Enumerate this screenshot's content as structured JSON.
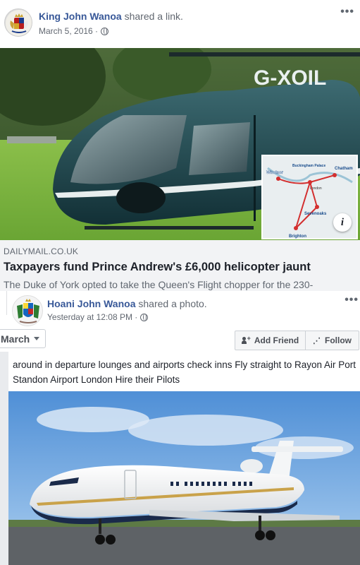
{
  "post1": {
    "author": "King John Wanoa",
    "action_prefix": " shared a ",
    "action_link": "link",
    "action_suffix": ".",
    "date": "March 5, 2016 ·",
    "options": "•••"
  },
  "heli_image": {
    "registration": "G-XOIL",
    "map_labels": [
      "Windsor",
      "Buckingham Palace",
      "London",
      "Chatham",
      "Sevenoaks",
      "Brighton"
    ],
    "info": "i"
  },
  "link_preview": {
    "domain": "DAILYMAIL.CO.UK",
    "title": "Taxpayers fund Prince Andrew's £6,000 helicopter jaunt",
    "description": "The Duke of York opted to take the Queen's Flight chopper for the 230-"
  },
  "post2": {
    "author": "Hoani John Wanoa",
    "action_prefix": " shared a ",
    "action_link": "photo",
    "action_suffix": ".",
    "date": "Yesterday at 12:08 PM ·",
    "options": "•••",
    "text": "around in departure lounges and airports check inns Fly straight to Rayon Air Port Standon Airport London Hire their Pilots"
  },
  "profile_bar": {
    "month_select": "March",
    "add_friend": "Add Friend",
    "follow": "Follow"
  },
  "colors": {
    "link_blue": "#385898",
    "meta_gray": "#616770",
    "preview_bg": "#f2f3f5"
  }
}
